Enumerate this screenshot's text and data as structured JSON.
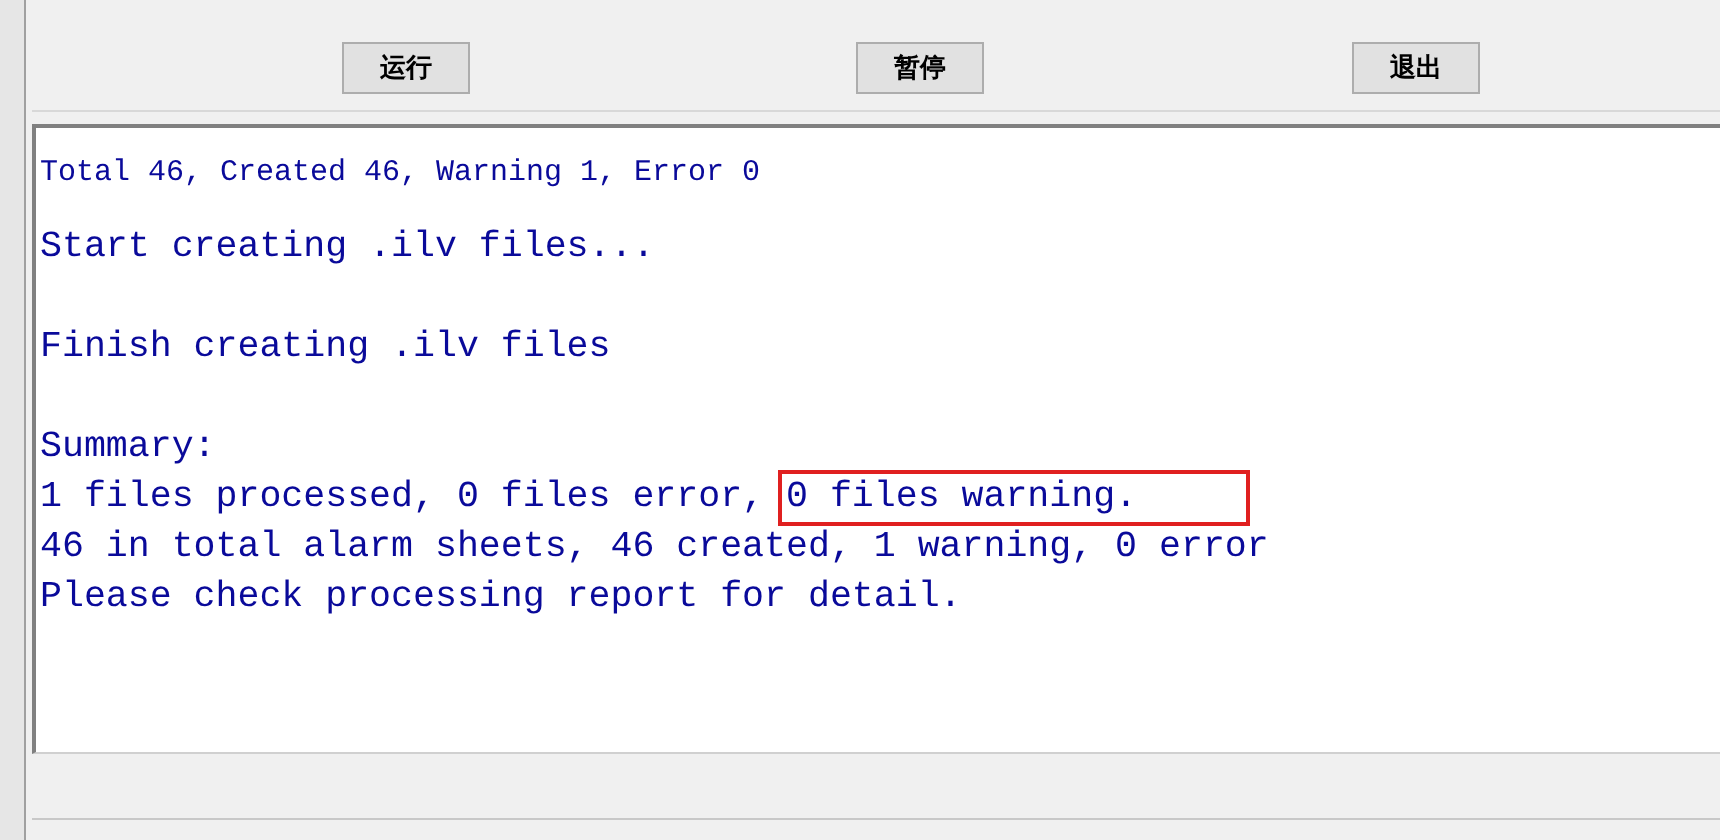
{
  "buttons": [
    {
      "label": "运行"
    },
    {
      "label": "暂停"
    },
    {
      "label": "退出"
    }
  ],
  "output": {
    "blocks": [
      {
        "kind": "small",
        "lines": [
          [
            {
              "text": "Total 46, Created 46, Warning 1, Error 0",
              "highlighted": false
            }
          ]
        ]
      },
      {
        "kind": "large",
        "lines": [
          [
            {
              "text": "Start creating .ilv files...",
              "highlighted": false
            }
          ]
        ]
      },
      {
        "kind": "large",
        "lines": [
          [
            {
              "text": "Finish creating .ilv files",
              "highlighted": false
            }
          ]
        ]
      },
      {
        "kind": "large",
        "lines": [
          [
            {
              "text": "Summary:",
              "highlighted": false
            }
          ],
          [
            {
              "text": "1 files processed, 0 files error, ",
              "highlighted": false
            },
            {
              "text": "0 files warning.",
              "highlighted": true
            }
          ],
          [
            {
              "text": "46 in total alarm sheets, 46 created, 1 warning, 0 error",
              "highlighted": false
            }
          ],
          [
            {
              "text": "Please check processing report for detail.",
              "highlighted": false
            }
          ]
        ]
      }
    ]
  }
}
